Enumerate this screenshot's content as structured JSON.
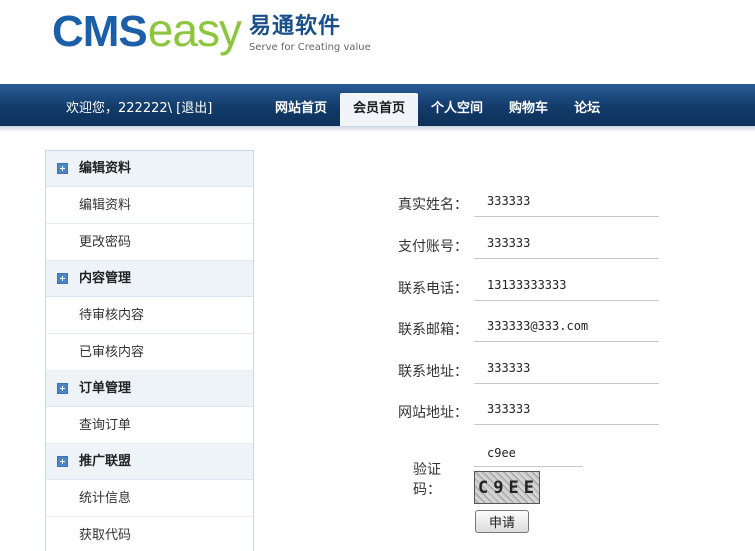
{
  "logo": {
    "cms": "CMS",
    "easy": "easy",
    "cn_name": "易通软件",
    "slogan": "Serve for Creating value"
  },
  "header": {
    "welcome_prefix": "欢迎您，222222\\ [",
    "logout": "退出",
    "welcome_suffix": "]"
  },
  "nav": {
    "items": [
      {
        "label": "网站首页",
        "active": false
      },
      {
        "label": "会员首页",
        "active": true
      },
      {
        "label": "个人空间",
        "active": false
      },
      {
        "label": "购物车",
        "active": false
      },
      {
        "label": "论坛",
        "active": false
      }
    ]
  },
  "sidebar": {
    "groups": [
      {
        "title": "编辑资料",
        "items": [
          "编辑资料",
          "更改密码"
        ]
      },
      {
        "title": "内容管理",
        "items": [
          "待审核内容",
          "已审核内容"
        ]
      },
      {
        "title": "订单管理",
        "items": [
          "查询订单"
        ]
      },
      {
        "title": "推广联盟",
        "items": [
          "统计信息",
          "获取代码"
        ]
      }
    ]
  },
  "form": {
    "fields": [
      {
        "label": "真实姓名：",
        "value": "333333"
      },
      {
        "label": "支付账号：",
        "value": "333333"
      },
      {
        "label": "联系电话：",
        "value": "13133333333"
      },
      {
        "label": "联系邮箱：",
        "value": "333333@333.com"
      },
      {
        "label": "联系地址：",
        "value": "333333"
      },
      {
        "label": "网站地址：",
        "value": "333333"
      }
    ],
    "captcha_label": "验证码：",
    "captcha_value": "c9ee",
    "captcha_image_text": "C9EE",
    "submit_label": "申请"
  },
  "colors": {
    "nav_dark": "#123c6b",
    "logo_blue": "#1b5fa8",
    "logo_green": "#8cc63f"
  }
}
